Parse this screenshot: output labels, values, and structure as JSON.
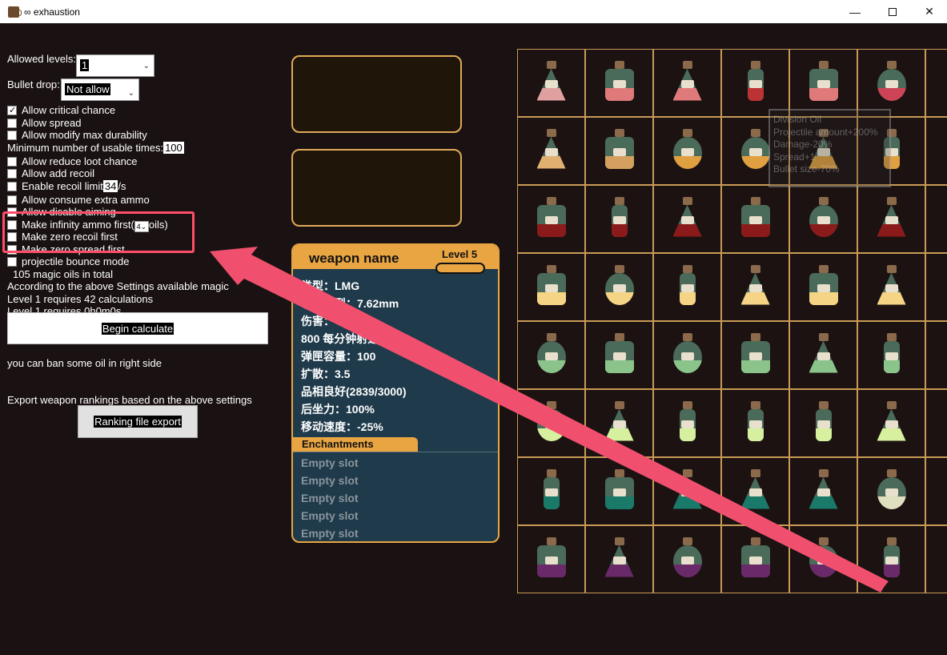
{
  "window": {
    "title": "∞ exhaustion",
    "min_glyph": "—",
    "close_glyph": "✕"
  },
  "settings": {
    "allowed_levels_label": "Allowed levels:",
    "allowed_levels_value": "1",
    "bullet_drop_label": "Bullet drop:",
    "bullet_drop_value": "Not allow",
    "allow_critical": "Allow critical chance",
    "allow_spread": "Allow spread",
    "allow_modify_max_durability": "Allow modify max durability",
    "min_usable_label": "Minimum number of usable times:",
    "min_usable_value": "100",
    "allow_reduce_loot": "Allow reduce loot chance",
    "allow_add_recoil": "Allow add recoil",
    "enable_recoil_limit": "Enable recoil limit",
    "recoil_limit_value": "34",
    "recoil_limit_unit": "/s",
    "allow_consume_extra_ammo": "Allow consume extra ammo",
    "allow_disable_aiming": "Allow disable aiming",
    "make_infinity_ammo": "Make infinity ammo first(",
    "infinity_oils_value": "4",
    "infinity_oils_suffix": "oils)",
    "make_zero_recoil": "Make zero recoil first",
    "make_zero_spread": "Make zero spread first",
    "projectile_bounce": "projectile bounce mode",
    "oils_total": "105 magic oils in total",
    "available_magic": "According to the above Settings available magic",
    "available_magic_tail": "",
    "level_calc": "Level 1 requires 42 calculations",
    "level_time": "Level 1 requires 0h0m0s",
    "begin_calculate": "Begin calculate",
    "ban_hint": "you can ban some oil in right side",
    "export_hint": "Export weapon rankings based on the above settings",
    "ranking_export": "Ranking file export"
  },
  "weapon_card": {
    "name": "weapon name",
    "level": "Level 5",
    "stats": [
      "类型：LMG",
      "子弹类型：7.62mm",
      "伤害：",
      "800 每分钟射速",
      "弹匣容量：100",
      "扩散：3.5",
      "品相良好(2839/3000)",
      "后坐力：100%",
      "移动速度：-25%"
    ],
    "enchantments_title": "Enchantments",
    "slots": [
      "Empty slot",
      "Empty slot",
      "Empty slot",
      "Empty slot",
      "Empty slot"
    ]
  },
  "tooltip": {
    "lines": [
      "Division Oil",
      "Projectile amount+200%",
      "Damage-20%",
      "Spread+1",
      "Bullet size-70%"
    ]
  },
  "colors": {
    "accent": "#e9a542",
    "card_bg": "#1f3a4a",
    "highlight": "#ff4d6a",
    "arrow": "#f0506e"
  },
  "potions": [
    {
      "shape": "tri",
      "liquid": "#e0a0a0"
    },
    {
      "shape": "sq",
      "liquid": "#e07a7a"
    },
    {
      "shape": "tri",
      "liquid": "#e07a7a"
    },
    {
      "shape": "slim",
      "liquid": "#b33"
    },
    {
      "shape": "sq",
      "liquid": "#e07a7a"
    },
    {
      "shape": "round",
      "liquid": "#c45"
    },
    {
      "shape": "slim",
      "liquid": "#c45"
    },
    {
      "shape": "tri",
      "liquid": "#e0b070"
    },
    {
      "shape": "sq",
      "liquid": "#d4a060"
    },
    {
      "shape": "round",
      "liquid": "#e0a040"
    },
    {
      "shape": "round",
      "liquid": "#e0a040"
    },
    {
      "shape": "tri",
      "liquid": "#e0a040"
    },
    {
      "shape": "slim",
      "liquid": "#e0a040"
    },
    {
      "shape": "slim",
      "liquid": "#e0a040"
    },
    {
      "shape": "sq",
      "liquid": "#8b1a1a"
    },
    {
      "shape": "slim",
      "liquid": "#8b1a1a"
    },
    {
      "shape": "tri",
      "liquid": "#8b1a1a"
    },
    {
      "shape": "sq",
      "liquid": "#8b1a1a"
    },
    {
      "shape": "round",
      "liquid": "#8b1a1a"
    },
    {
      "shape": "tri",
      "liquid": "#8b1a1a"
    },
    {
      "shape": "slim",
      "liquid": "#8b1a1a"
    },
    {
      "shape": "sq",
      "liquid": "#f5d585"
    },
    {
      "shape": "round",
      "liquid": "#f5d585"
    },
    {
      "shape": "slim",
      "liquid": "#f5d585"
    },
    {
      "shape": "tri",
      "liquid": "#f5d585"
    },
    {
      "shape": "sq",
      "liquid": "#f5d585"
    },
    {
      "shape": "tri",
      "liquid": "#f5d585"
    },
    {
      "shape": "slim",
      "liquid": "#f5d585"
    },
    {
      "shape": "round",
      "liquid": "#8bc48b"
    },
    {
      "shape": "sq",
      "liquid": "#8bc48b"
    },
    {
      "shape": "round",
      "liquid": "#8bc48b"
    },
    {
      "shape": "sq",
      "liquid": "#8bc48b"
    },
    {
      "shape": "tri",
      "liquid": "#8bc48b"
    },
    {
      "shape": "slim",
      "liquid": "#8bc48b"
    },
    {
      "shape": "slim",
      "liquid": "#8bc48b"
    },
    {
      "shape": "round",
      "liquid": "#d6f0a0"
    },
    {
      "shape": "tri",
      "liquid": "#d6f0a0"
    },
    {
      "shape": "slim",
      "liquid": "#d6f0a0"
    },
    {
      "shape": "slim",
      "liquid": "#d6f0a0"
    },
    {
      "shape": "slim",
      "liquid": "#d6f0a0"
    },
    {
      "shape": "tri",
      "liquid": "#d6f0a0"
    },
    {
      "shape": "slim",
      "liquid": "#d6f0a0"
    },
    {
      "shape": "slim",
      "liquid": "#1a7a6a"
    },
    {
      "shape": "sq",
      "liquid": "#1a7a6a"
    },
    {
      "shape": "tri",
      "liquid": "#1a7a6a"
    },
    {
      "shape": "tri",
      "liquid": "#1a7a6a"
    },
    {
      "shape": "tri",
      "liquid": "#1a7a6a"
    },
    {
      "shape": "round",
      "liquid": "#e0e0c0"
    },
    {
      "shape": "slim",
      "liquid": "#1a7a6a"
    },
    {
      "shape": "sq",
      "liquid": "#6a2a6a"
    },
    {
      "shape": "tri",
      "liquid": "#6a2a6a"
    },
    {
      "shape": "round",
      "liquid": "#6a2a6a"
    },
    {
      "shape": "sq",
      "liquid": "#6a2a6a"
    },
    {
      "shape": "round",
      "liquid": "#6a2a6a"
    },
    {
      "shape": "slim",
      "liquid": "#6a2a6a"
    },
    {
      "shape": "slim",
      "liquid": "#6a2a6a"
    }
  ]
}
